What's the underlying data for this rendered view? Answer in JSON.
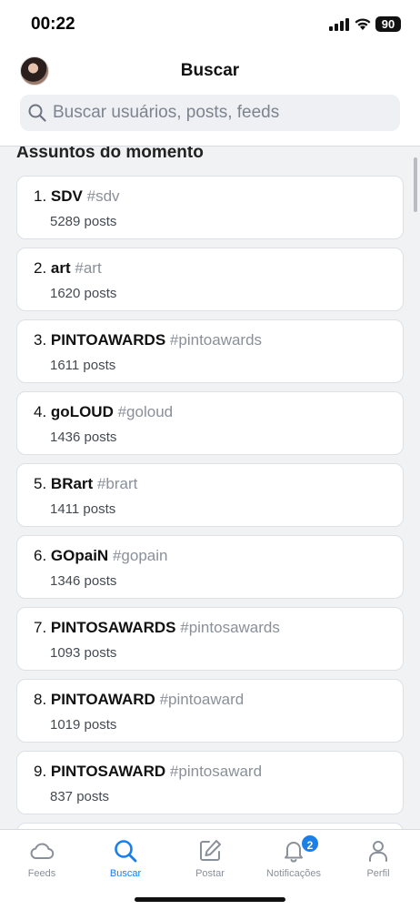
{
  "status_bar": {
    "time": "00:22",
    "battery": "90"
  },
  "header": {
    "title": "Buscar",
    "search_placeholder": "Buscar usuários, posts, feeds"
  },
  "section": {
    "title": "Assuntos do momento"
  },
  "trends": [
    {
      "rank": "1.",
      "name": "SDV",
      "tag": "#sdv",
      "count": "5289 posts"
    },
    {
      "rank": "2.",
      "name": "art",
      "tag": "#art",
      "count": "1620 posts"
    },
    {
      "rank": "3.",
      "name": "PINTOAWARDS",
      "tag": "#pintoawards",
      "count": "1611 posts"
    },
    {
      "rank": "4.",
      "name": "goLOUD",
      "tag": "#goloud",
      "count": "1436 posts"
    },
    {
      "rank": "5.",
      "name": "BRart",
      "tag": "#brart",
      "count": "1411 posts"
    },
    {
      "rank": "6.",
      "name": "GOpaiN",
      "tag": "#gopain",
      "count": "1346 posts"
    },
    {
      "rank": "7.",
      "name": "PINTOSAWARDS",
      "tag": "#pintosawards",
      "count": "1093 posts"
    },
    {
      "rank": "8.",
      "name": "PINTOAWARD",
      "tag": "#pintoaward",
      "count": "1019 posts"
    },
    {
      "rank": "9.",
      "name": "PINTOSAWARD",
      "tag": "#pintosaward",
      "count": "837 posts"
    },
    {
      "rank": "",
      "name": "",
      "tag": "",
      "count": ""
    }
  ],
  "tabs": [
    {
      "label": "Feeds",
      "icon": "cloud-icon"
    },
    {
      "label": "Buscar",
      "icon": "search-icon",
      "active": true
    },
    {
      "label": "Postar",
      "icon": "compose-icon"
    },
    {
      "label": "Notificações",
      "icon": "bell-icon",
      "badge": "2"
    },
    {
      "label": "Perfil",
      "icon": "person-icon"
    }
  ],
  "colors": {
    "accent": "#1a7fe8",
    "muted": "#8a9099",
    "background": "#f1f2f4"
  }
}
